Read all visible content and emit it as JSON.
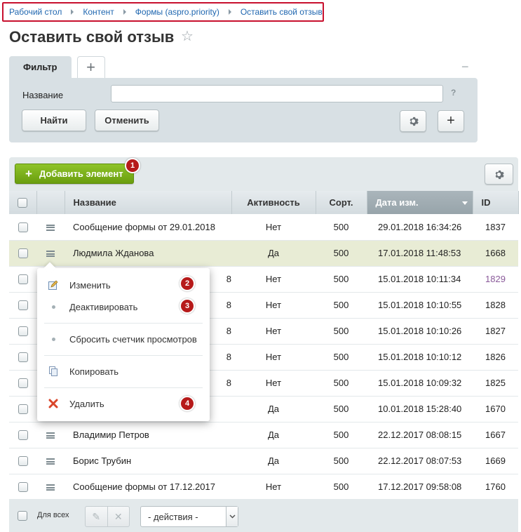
{
  "breadcrumb": [
    "Рабочий стол",
    "Контент",
    "Формы (aspro.priority)",
    "Оставить свой отзыв"
  ],
  "page_title": "Оставить свой отзыв",
  "filter": {
    "tab_label": "Фильтр",
    "add_tab": "+",
    "collapse": "−",
    "name_label": "Название",
    "name_value": "",
    "help": "?",
    "find_label": "Найти",
    "cancel_label": "Отменить",
    "add_label": "+"
  },
  "toolbar": {
    "add_element_label": "Добавить элемент",
    "badge_1": "1"
  },
  "columns": [
    "Название",
    "Активность",
    "Сорт.",
    "Дата изм.",
    "ID"
  ],
  "rows": [
    {
      "name": "Сообщение формы от 29.01.2018",
      "active": "Нет",
      "sort": "500",
      "date": "29.01.2018 16:34:26",
      "id": "1837"
    },
    {
      "name": "Людмила Жданова",
      "active": "Да",
      "sort": "500",
      "date": "17.01.2018 11:48:53",
      "id": "1668"
    },
    {
      "name": "8",
      "active": "Нет",
      "sort": "500",
      "date": "15.01.2018 10:11:34",
      "id": "1829"
    },
    {
      "name": "8",
      "active": "Нет",
      "sort": "500",
      "date": "15.01.2018 10:10:55",
      "id": "1828"
    },
    {
      "name": "8",
      "active": "Нет",
      "sort": "500",
      "date": "15.01.2018 10:10:26",
      "id": "1827"
    },
    {
      "name": "8",
      "active": "Нет",
      "sort": "500",
      "date": "15.01.2018 10:10:12",
      "id": "1826"
    },
    {
      "name": "8",
      "active": "Нет",
      "sort": "500",
      "date": "15.01.2018 10:09:32",
      "id": "1825"
    },
    {
      "name": "",
      "active": "Да",
      "sort": "500",
      "date": "10.01.2018 15:28:40",
      "id": "1670"
    },
    {
      "name": "Владимир Петров",
      "active": "Да",
      "sort": "500",
      "date": "22.12.2017 08:08:15",
      "id": "1667"
    },
    {
      "name": "Борис Трубин",
      "active": "Да",
      "sort": "500",
      "date": "22.12.2017 08:07:53",
      "id": "1669"
    },
    {
      "name": "Сообщение формы от 17.12.2017",
      "active": "Нет",
      "sort": "500",
      "date": "17.12.2017 09:58:08",
      "id": "1760"
    }
  ],
  "context_menu": {
    "edit": "Изменить",
    "deactivate": "Деактивировать",
    "reset_counter": "Сбросить счетчик просмотров",
    "copy": "Копировать",
    "delete": "Удалить",
    "badge_2": "2",
    "badge_3": "3",
    "badge_4": "4"
  },
  "footer": {
    "for_all_label": "Для всех",
    "actions_placeholder": "- действия -"
  },
  "colors": {
    "accent_link": "#2067b0",
    "add_button": "#7cb31c",
    "highlight_row": "#e8ecd5",
    "badge": "#b61a1a",
    "breadcrumb_border": "#c8102e"
  }
}
